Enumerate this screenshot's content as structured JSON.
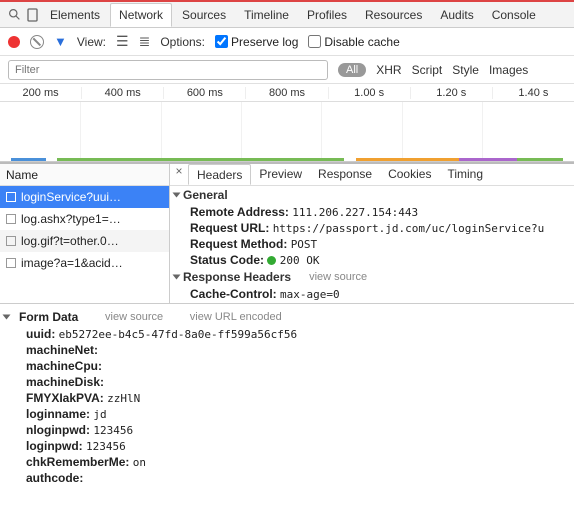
{
  "top_tabs": {
    "elements": "Elements",
    "network": "Network",
    "sources": "Sources",
    "timeline": "Timeline",
    "profiles": "Profiles",
    "resources": "Resources",
    "audits": "Audits",
    "console": "Console"
  },
  "toolbar": {
    "view": "View:",
    "options": "Options:",
    "preserve": "Preserve log",
    "disable_cache": "Disable cache"
  },
  "filter": {
    "placeholder": "Filter",
    "all": "All",
    "xhr": "XHR",
    "script": "Script",
    "style": "Style",
    "images": "Images"
  },
  "times": [
    "200 ms",
    "400 ms",
    "600 ms",
    "800 ms",
    "1.00 s",
    "1.20 s",
    "1.40 s"
  ],
  "left": {
    "head": "Name",
    "rows": [
      {
        "label": "loginService?uui…",
        "sel": true
      },
      {
        "label": "log.ashx?type1=…",
        "sel": false
      },
      {
        "label": "log.gif?t=other.0…",
        "sel": false
      },
      {
        "label": "image?a=1&acid…",
        "sel": false
      }
    ]
  },
  "sub_tabs": {
    "headers": "Headers",
    "preview": "Preview",
    "response": "Response",
    "cookies": "Cookies",
    "timing": "Timing"
  },
  "general": {
    "title": "General",
    "remote_k": "Remote Address:",
    "remote_v": "111.206.227.154:443",
    "url_k": "Request URL:",
    "url_v": "https://passport.jd.com/uc/loginService?u",
    "method_k": "Request Method:",
    "method_v": "POST",
    "status_k": "Status Code:",
    "status_v": "200 OK"
  },
  "resp_headers": {
    "title": "Response Headers",
    "view_source": "view source",
    "cc_k": "Cache-Control:",
    "cc_v": "max-age=0"
  },
  "form": {
    "title": "Form Data",
    "view_source": "view source",
    "view_url": "view URL encoded",
    "fields": [
      {
        "k": "uuid:",
        "v": "eb5272ee-b4c5-47fd-8a0e-ff599a56cf56"
      },
      {
        "k": "machineNet:",
        "v": ""
      },
      {
        "k": "machineCpu:",
        "v": ""
      },
      {
        "k": "machineDisk:",
        "v": ""
      },
      {
        "k": "FMYXIakPVA:",
        "v": "zzHlN"
      },
      {
        "k": "loginname:",
        "v": "jd"
      },
      {
        "k": "nloginpwd:",
        "v": "123456"
      },
      {
        "k": "loginpwd:",
        "v": "123456"
      },
      {
        "k": "chkRememberMe:",
        "v": "on"
      },
      {
        "k": "authcode:",
        "v": ""
      }
    ]
  }
}
